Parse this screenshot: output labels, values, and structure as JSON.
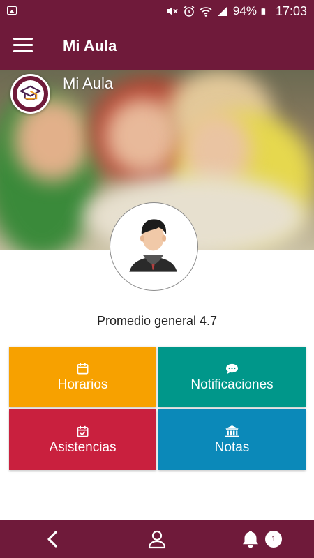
{
  "status_bar": {
    "battery": "94%",
    "time": "17:03"
  },
  "app_bar": {
    "title": "Mi Aula"
  },
  "hero": {
    "title": "Mi Aula"
  },
  "profile": {
    "average_text": "Promedio general 4.7"
  },
  "tiles": [
    {
      "label": "Horarios",
      "icon": "calendar-icon",
      "color": "#f7a100"
    },
    {
      "label": "Notificaciones",
      "icon": "comment-icon",
      "color": "#00978a"
    },
    {
      "label": "Asistencias",
      "icon": "calendar-check-icon",
      "color": "#c9203e"
    },
    {
      "label": "Notas",
      "icon": "bank-icon",
      "color": "#0b89b9"
    }
  ],
  "bottom_bar": {
    "badge_count": "1"
  },
  "colors": {
    "primary": "#6f1a3a"
  }
}
